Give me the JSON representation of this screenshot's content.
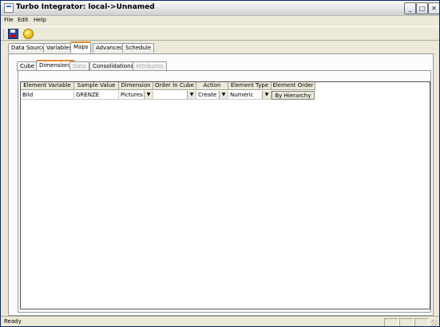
{
  "window": {
    "title": "Turbo Integrator:  local->Unnamed"
  },
  "menu": [
    "File",
    "Edit",
    "Help"
  ],
  "toolbar": {
    "icons": [
      "save-icon",
      "run-icon"
    ]
  },
  "tabs_main": [
    {
      "label": "Data Source",
      "active": false
    },
    {
      "label": "Variables",
      "active": false
    },
    {
      "label": "Maps",
      "active": true
    },
    {
      "label": "Advanced",
      "active": false
    },
    {
      "label": "Schedule",
      "active": false
    }
  ],
  "tabs_sub": [
    {
      "label": "Cube",
      "active": false,
      "disabled": false
    },
    {
      "label": "Dimensions",
      "active": true,
      "disabled": false
    },
    {
      "label": "Data",
      "active": false,
      "disabled": true
    },
    {
      "label": "Consolidations",
      "active": false,
      "disabled": false
    },
    {
      "label": "Attributes",
      "active": false,
      "disabled": true
    }
  ],
  "grid": {
    "columns": [
      "Element Variable",
      "Sample Value",
      "Dimension",
      "Order In Cube",
      "Action",
      "Element Type",
      "Element Order"
    ],
    "rows": [
      {
        "element_variable": "Bild",
        "sample_value": "GRENZE",
        "dimension": "Pictures",
        "order_in_cube": "",
        "action": "Create",
        "element_type": "Numeric",
        "element_order": "By Hierarchy"
      }
    ]
  },
  "status": {
    "text": "Ready"
  }
}
